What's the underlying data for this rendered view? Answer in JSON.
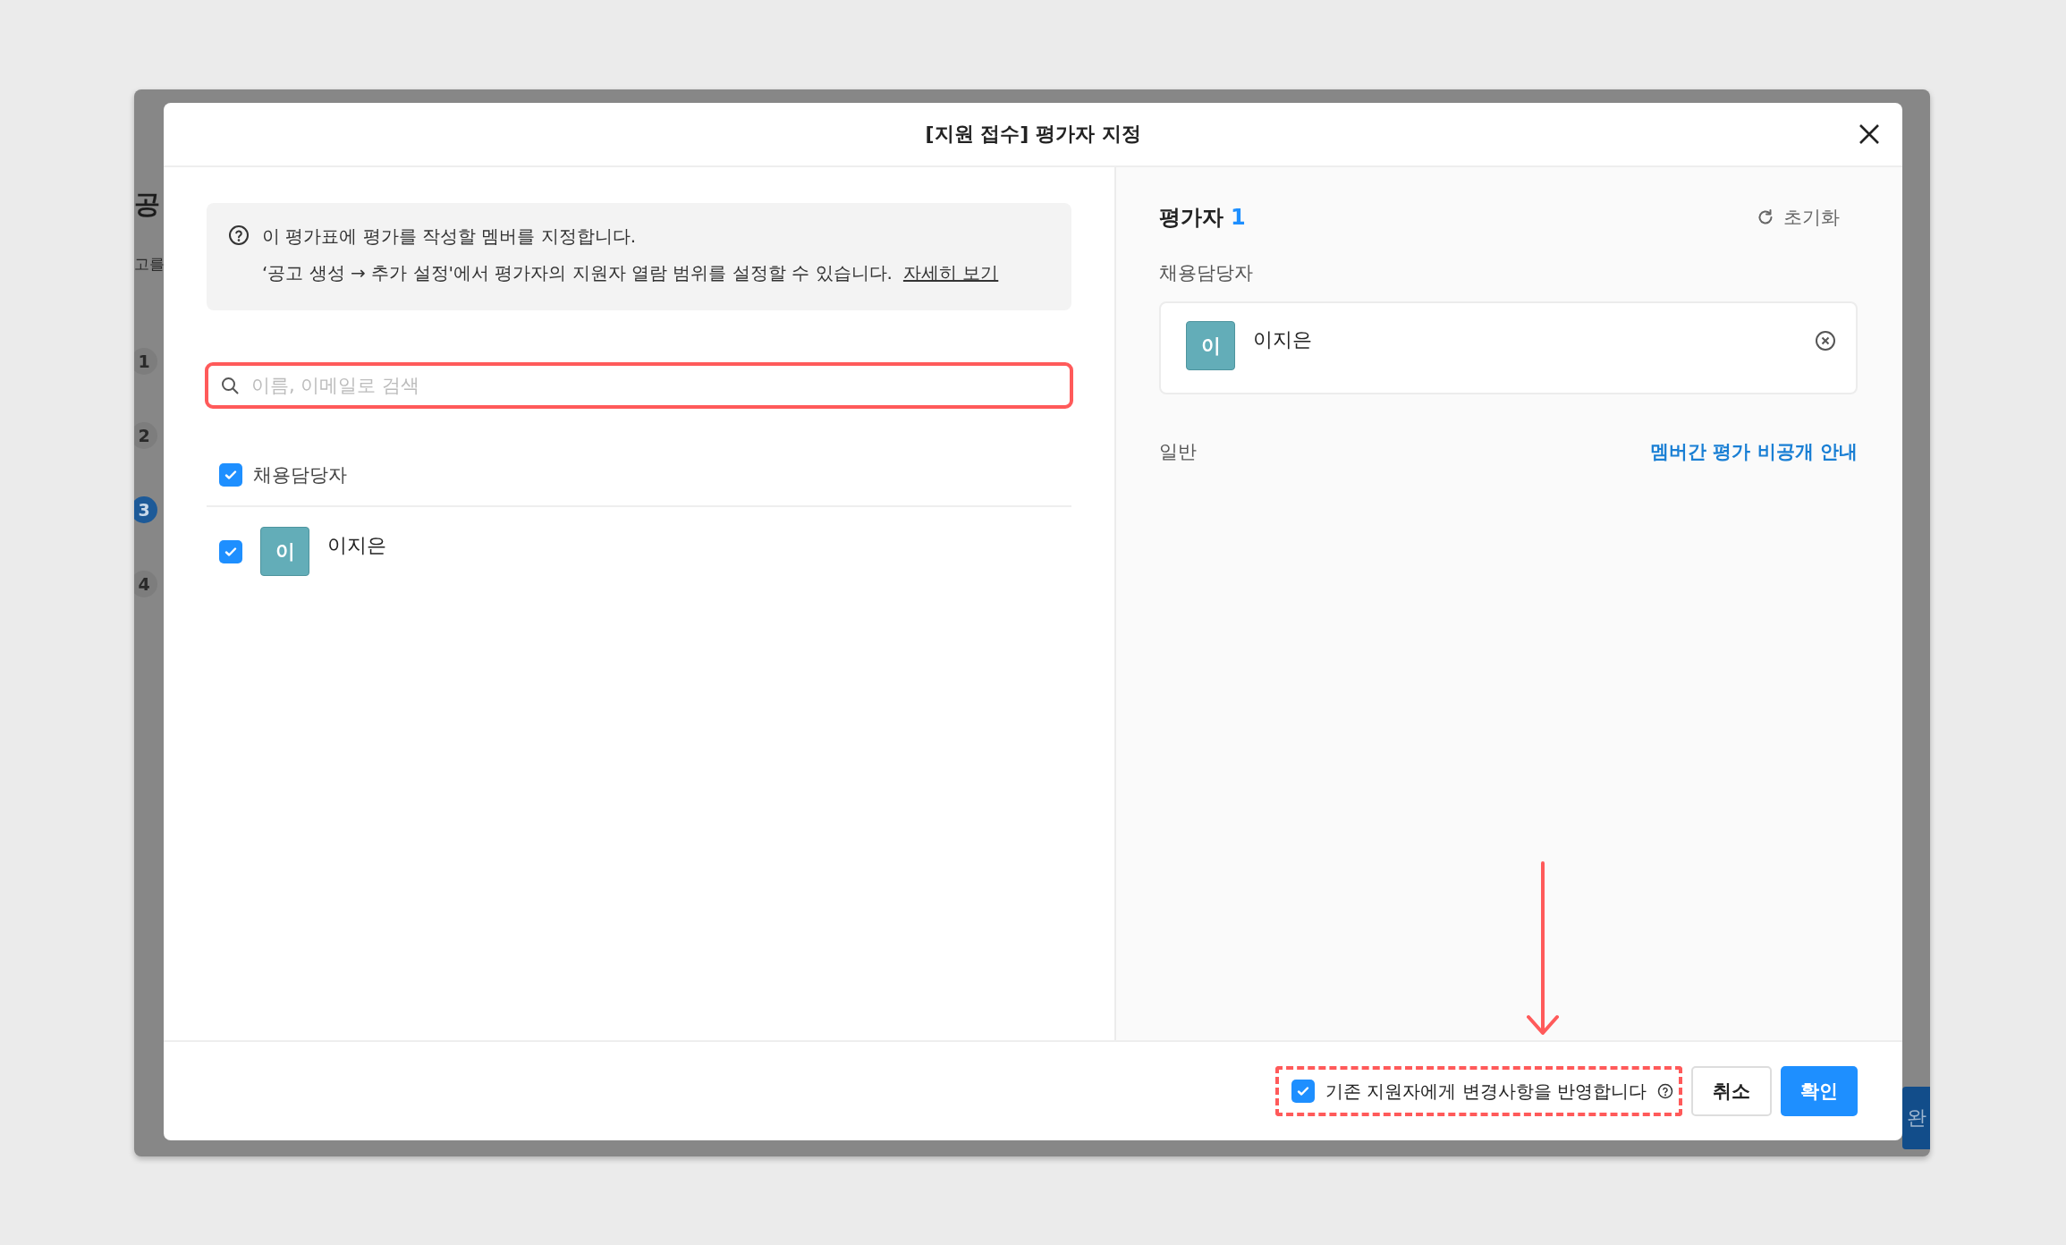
{
  "background": {
    "heading": "공",
    "subtext": "고를",
    "steps": [
      {
        "label": "1",
        "selected": false
      },
      {
        "label": "2",
        "selected": false
      },
      {
        "label": "3",
        "selected": true
      },
      {
        "label": "4",
        "selected": false
      }
    ],
    "button": "완"
  },
  "dialog": {
    "title": "[지원 접수] 평가자 지정"
  },
  "notice": {
    "text": "이 평가표에 평가를 작성할 멤버를 지정합니다.",
    "detail": "‘공고 생성 → 추가 설정'에서 평가자의 지원자 열람 범위를 설정할 수 있습니다.",
    "link": "자세히 보기"
  },
  "search": {
    "placeholder": "이름, 이메일로 검색"
  },
  "groups": [
    {
      "label": "채용담당자",
      "checked": true,
      "members": [
        {
          "initial": "이",
          "name": "이지은",
          "checked": true
        }
      ]
    }
  ],
  "evaluators": {
    "title": "평가자",
    "count": "1",
    "reset": "초기화",
    "sections": [
      {
        "label": "채용담당자",
        "members": [
          {
            "initial": "이",
            "name": "이지은"
          }
        ]
      },
      {
        "label": "일반",
        "link": "멤버간 평가 비공개 안내"
      }
    ]
  },
  "footer": {
    "apply_existing": {
      "label": "기존 지원자에게 변경사항을 반영합니다",
      "checked": true
    },
    "buttons": [
      {
        "label": "취소",
        "kind": "secondary"
      },
      {
        "label": "확인",
        "kind": "primary"
      }
    ]
  }
}
